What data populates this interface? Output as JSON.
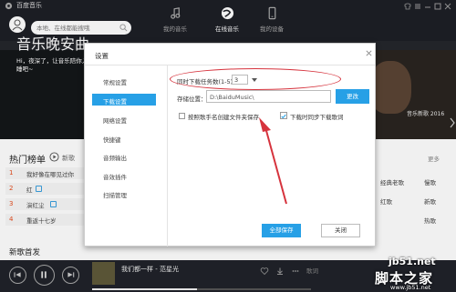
{
  "app": {
    "title": "百度音乐"
  },
  "search": {
    "placeholder": "本地、在线都能搜哦"
  },
  "nav": {
    "tabs": [
      {
        "label": "我的音乐",
        "active": false
      },
      {
        "label": "在线音乐",
        "active": true
      },
      {
        "label": "我的设备",
        "active": false
      }
    ]
  },
  "banner": {
    "headline": "音乐晚安曲",
    "subtitle": "Hi，夜深了，让音乐陪你入睡吧~",
    "right_caption": "音乐新歌 2016"
  },
  "hot": {
    "title": "热门榜单",
    "new_label": "新歌",
    "more": "更多",
    "rows": [
      {
        "rank": "1",
        "song": "我好像在哪见过你"
      },
      {
        "rank": "2",
        "song": "红"
      },
      {
        "rank": "3",
        "song": "演红尘"
      },
      {
        "rank": "4",
        "song": "重返十七岁"
      }
    ],
    "tags": [
      [
        "经典老歌",
        "慢歌"
      ],
      [
        "红歌",
        "新歌"
      ],
      [
        "",
        "热歌"
      ]
    ]
  },
  "new_release": {
    "title": "新歌首发"
  },
  "player": {
    "now_playing": "我们都一样 - 范星光",
    "progress": 0.48,
    "lyrics_label": "歌词"
  },
  "dialog": {
    "title": "设置",
    "sidebar": [
      {
        "label": "常规设置",
        "active": false
      },
      {
        "label": "下载设置",
        "active": true
      },
      {
        "label": "网络设置",
        "active": false
      },
      {
        "label": "快捷键",
        "active": false
      },
      {
        "label": "音频输出",
        "active": false
      },
      {
        "label": "音效插件",
        "active": false
      },
      {
        "label": "扫描管理",
        "active": false
      }
    ],
    "download_count_label": "同时下载任务数(1-5)",
    "download_count_value": "3",
    "path_label": "存储位置：",
    "path_value": "D:\\BaiduMusic\\",
    "change_button": "更改",
    "checkbox_folder": {
      "label": "按照歌手名创建文件夹保存",
      "checked": false
    },
    "checkbox_lyrics": {
      "label": "下载时同步下载歌词",
      "checked": true
    },
    "save_button": "全部保存",
    "cancel_button": "关闭"
  },
  "watermark": {
    "domain": "jb51.net",
    "cn": "脚本之家",
    "url": "www.jb51.net"
  },
  "colors": {
    "accent": "#27a0e6",
    "annotation": "#d6333d",
    "topbar": "#1d1f26"
  }
}
